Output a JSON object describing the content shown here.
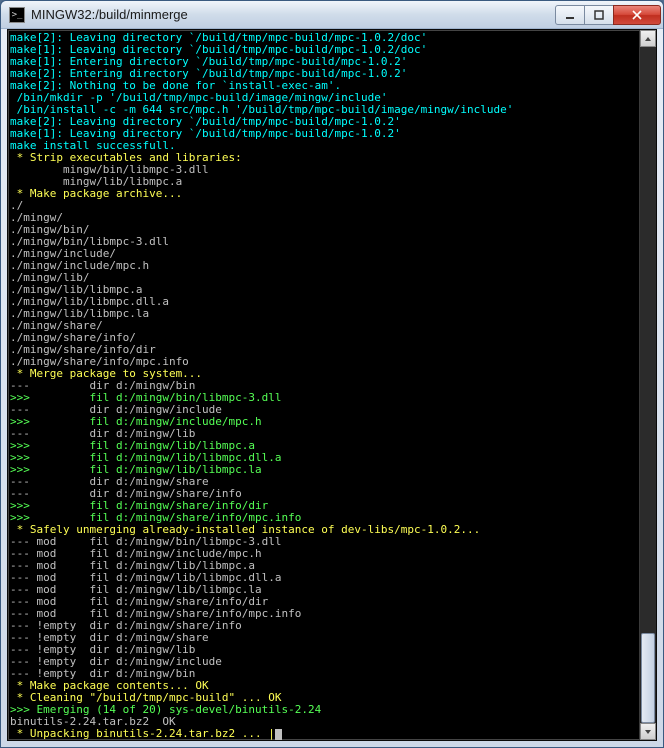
{
  "window": {
    "title": "MINGW32:/build/minmerge"
  },
  "terminal": {
    "lines": [
      {
        "cls": "c-cyan",
        "t": "make[2]: Leaving directory `/build/tmp/mpc-build/mpc-1.0.2/doc'"
      },
      {
        "cls": "c-cyan",
        "t": "make[1]: Leaving directory `/build/tmp/mpc-build/mpc-1.0.2/doc'"
      },
      {
        "cls": "c-cyan",
        "t": "make[1]: Entering directory `/build/tmp/mpc-build/mpc-1.0.2'"
      },
      {
        "cls": "c-cyan",
        "t": "make[2]: Entering directory `/build/tmp/mpc-build/mpc-1.0.2'"
      },
      {
        "cls": "c-cyan",
        "t": "make[2]: Nothing to be done for `install-exec-am'."
      },
      {
        "cls": "c-cyan",
        "t": " /bin/mkdir -p '/build/tmp/mpc-build/image/mingw/include'"
      },
      {
        "cls": "c-cyan",
        "t": " /bin/install -c -m 644 src/mpc.h '/build/tmp/mpc-build/image/mingw/include'"
      },
      {
        "cls": "c-cyan",
        "t": "make[2]: Leaving directory `/build/tmp/mpc-build/mpc-1.0.2'"
      },
      {
        "cls": "c-cyan",
        "t": "make[1]: Leaving directory `/build/tmp/mpc-build/mpc-1.0.2'"
      },
      {
        "cls": "c-cyan",
        "t": "make install successfull."
      },
      {
        "cls": "c-yel",
        "t": " * Strip executables and libraries:"
      },
      {
        "cls": "c-gray",
        "t": "        mingw/bin/libmpc-3.dll"
      },
      {
        "cls": "c-gray",
        "t": "        mingw/lib/libmpc.a"
      },
      {
        "cls": "c-yel",
        "t": " * Make package archive..."
      },
      {
        "cls": "c-gray",
        "t": "./"
      },
      {
        "cls": "c-gray",
        "t": "./mingw/"
      },
      {
        "cls": "c-gray",
        "t": "./mingw/bin/"
      },
      {
        "cls": "c-gray",
        "t": "./mingw/bin/libmpc-3.dll"
      },
      {
        "cls": "c-gray",
        "t": "./mingw/include/"
      },
      {
        "cls": "c-gray",
        "t": "./mingw/include/mpc.h"
      },
      {
        "cls": "c-gray",
        "t": "./mingw/lib/"
      },
      {
        "cls": "c-gray",
        "t": "./mingw/lib/libmpc.a"
      },
      {
        "cls": "c-gray",
        "t": "./mingw/lib/libmpc.dll.a"
      },
      {
        "cls": "c-gray",
        "t": "./mingw/lib/libmpc.la"
      },
      {
        "cls": "c-gray",
        "t": "./mingw/share/"
      },
      {
        "cls": "c-gray",
        "t": "./mingw/share/info/"
      },
      {
        "cls": "c-gray",
        "t": "./mingw/share/info/dir"
      },
      {
        "cls": "c-gray",
        "t": "./mingw/share/info/mpc.info"
      },
      {
        "cls": "c-yel",
        "t": " * Merge package to system..."
      },
      {
        "cls": "c-gray",
        "t": "---         dir d:/mingw/bin"
      },
      {
        "cls": "c-grn",
        "t": ">>>         fil d:/mingw/bin/libmpc-3.dll"
      },
      {
        "cls": "c-gray",
        "t": "---         dir d:/mingw/include"
      },
      {
        "cls": "c-grn",
        "t": ">>>         fil d:/mingw/include/mpc.h"
      },
      {
        "cls": "c-gray",
        "t": "---         dir d:/mingw/lib"
      },
      {
        "cls": "c-grn",
        "t": ">>>         fil d:/mingw/lib/libmpc.a"
      },
      {
        "cls": "c-grn",
        "t": ">>>         fil d:/mingw/lib/libmpc.dll.a"
      },
      {
        "cls": "c-grn",
        "t": ">>>         fil d:/mingw/lib/libmpc.la"
      },
      {
        "cls": "c-gray",
        "t": "---         dir d:/mingw/share"
      },
      {
        "cls": "c-gray",
        "t": "---         dir d:/mingw/share/info"
      },
      {
        "cls": "c-grn",
        "t": ">>>         fil d:/mingw/share/info/dir"
      },
      {
        "cls": "c-grn",
        "t": ">>>         fil d:/mingw/share/info/mpc.info"
      },
      {
        "cls": "c-yel",
        "t": " * Safely unmerging already-installed instance of dev-libs/mpc-1.0.2..."
      },
      {
        "cls": "c-gray",
        "t": "--- mod     fil d:/mingw/bin/libmpc-3.dll"
      },
      {
        "cls": "c-gray",
        "t": "--- mod     fil d:/mingw/include/mpc.h"
      },
      {
        "cls": "c-gray",
        "t": "--- mod     fil d:/mingw/lib/libmpc.a"
      },
      {
        "cls": "c-gray",
        "t": "--- mod     fil d:/mingw/lib/libmpc.dll.a"
      },
      {
        "cls": "c-gray",
        "t": "--- mod     fil d:/mingw/lib/libmpc.la"
      },
      {
        "cls": "c-gray",
        "t": "--- mod     fil d:/mingw/share/info/dir"
      },
      {
        "cls": "c-gray",
        "t": "--- mod     fil d:/mingw/share/info/mpc.info"
      },
      {
        "cls": "c-gray",
        "t": "--- !empty  dir d:/mingw/share/info"
      },
      {
        "cls": "c-gray",
        "t": "--- !empty  dir d:/mingw/share"
      },
      {
        "cls": "c-gray",
        "t": "--- !empty  dir d:/mingw/lib"
      },
      {
        "cls": "c-gray",
        "t": "--- !empty  dir d:/mingw/include"
      },
      {
        "cls": "c-gray",
        "t": "--- !empty  dir d:/mingw/bin"
      },
      {
        "cls": "c-yel",
        "t": " * Make package contents... OK"
      },
      {
        "cls": "c-yel",
        "t": " * Cleaning \"/build/tmp/mpc-build\" ... OK"
      },
      {
        "cls": "c-grn",
        "t": ">>> Emerging (14 of 20) sys-devel/binutils-2.24"
      },
      {
        "cls": "c-gray",
        "t": "binutils-2.24.tar.bz2  OK"
      },
      {
        "cls": "c-yel",
        "t": " * Unpacking binutils-2.24.tar.bz2 ... |",
        "cursor": true
      }
    ]
  }
}
